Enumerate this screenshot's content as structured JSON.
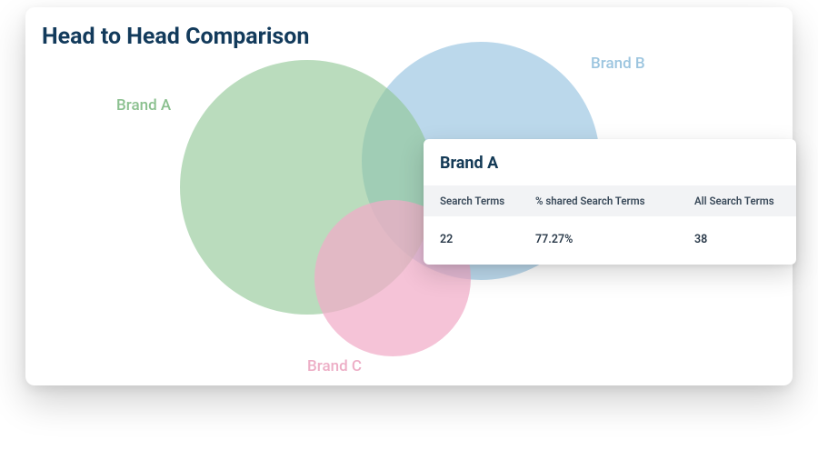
{
  "title": "Head to Head Comparison",
  "chart_data": {
    "type": "venn",
    "sets": [
      {
        "name": "Brand A",
        "color": "#9bcfa0"
      },
      {
        "name": "Brand B",
        "color": "#a8d0e8"
      },
      {
        "name": "Brand C",
        "color": "#f2b5cd"
      }
    ],
    "selected": {
      "set": "Brand A",
      "search_terms": 22,
      "percent_shared": "77.27%",
      "all_search_terms": 38
    }
  },
  "labels": {
    "brandA": "Brand A",
    "brandB": "Brand B",
    "brandC": "Brand C"
  },
  "tooltip": {
    "title": "Brand A",
    "headers": {
      "searchTerms": "Search Terms",
      "pctShared": "% shared Search Terms",
      "allSearchTerms": "All Search Terms"
    },
    "values": {
      "searchTerms": "22",
      "pctShared": "77.27%",
      "allSearchTerms": "38"
    }
  }
}
